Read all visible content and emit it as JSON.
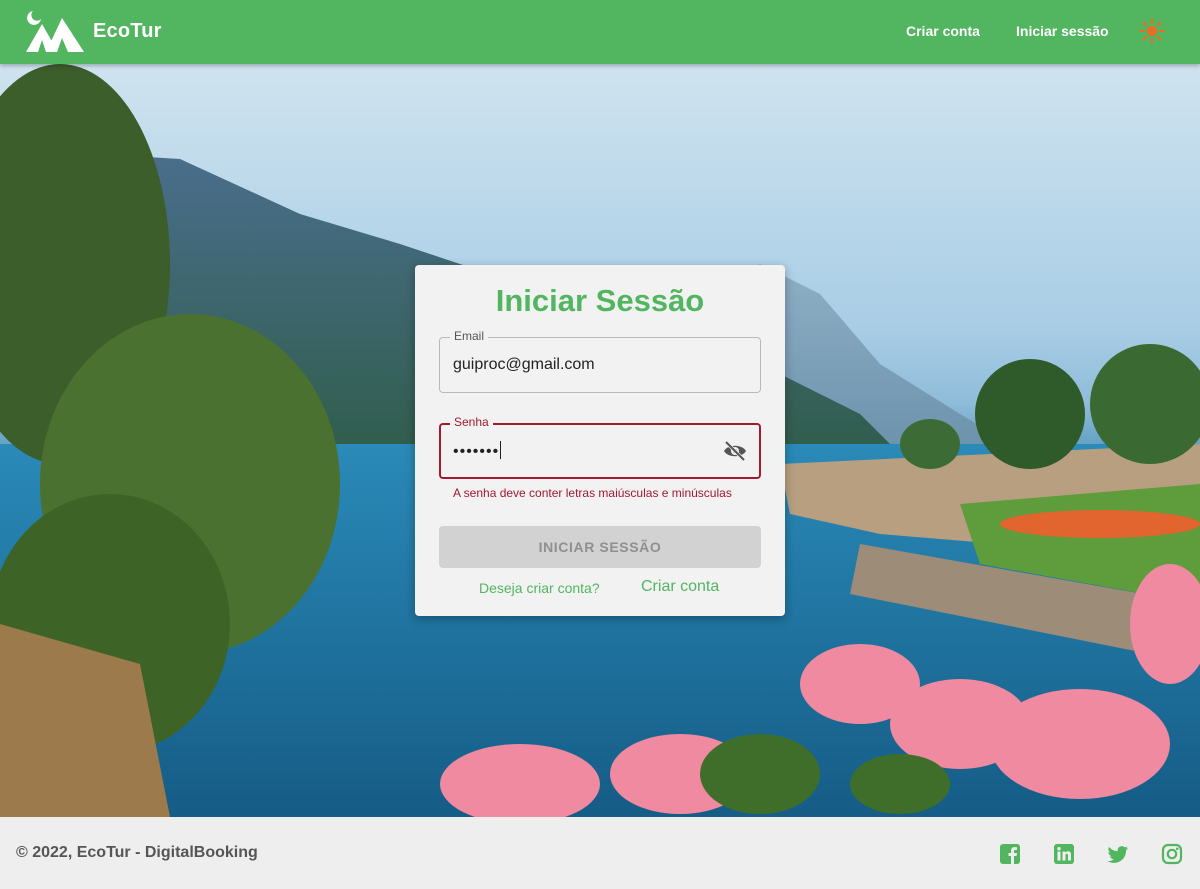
{
  "header": {
    "brand": "EcoTur",
    "nav": {
      "create_account": "Criar conta",
      "login": "Iniciar sessão"
    },
    "theme_icon": "sun-icon",
    "color": "#52b55f"
  },
  "login_form": {
    "title": "Iniciar Sessão",
    "email": {
      "label": "Email",
      "value": "guiproc@gmail.com"
    },
    "password": {
      "label": "Senha",
      "value": "•••••••",
      "toggle_icon": "eye-off-icon"
    },
    "error": "A senha deve conter letras maiúsculas e minúsculas",
    "submit_label": "INICIAR SESSÃO",
    "prompt": "Deseja criar conta?",
    "create_link": "Criar conta",
    "accent_color": "#52b55f",
    "error_color": "#a3192f"
  },
  "footer": {
    "copyright": "© 2022, EcoTur - DigitalBooking",
    "social": [
      "facebook-icon",
      "linkedin-icon",
      "twitter-icon",
      "instagram-icon"
    ]
  }
}
